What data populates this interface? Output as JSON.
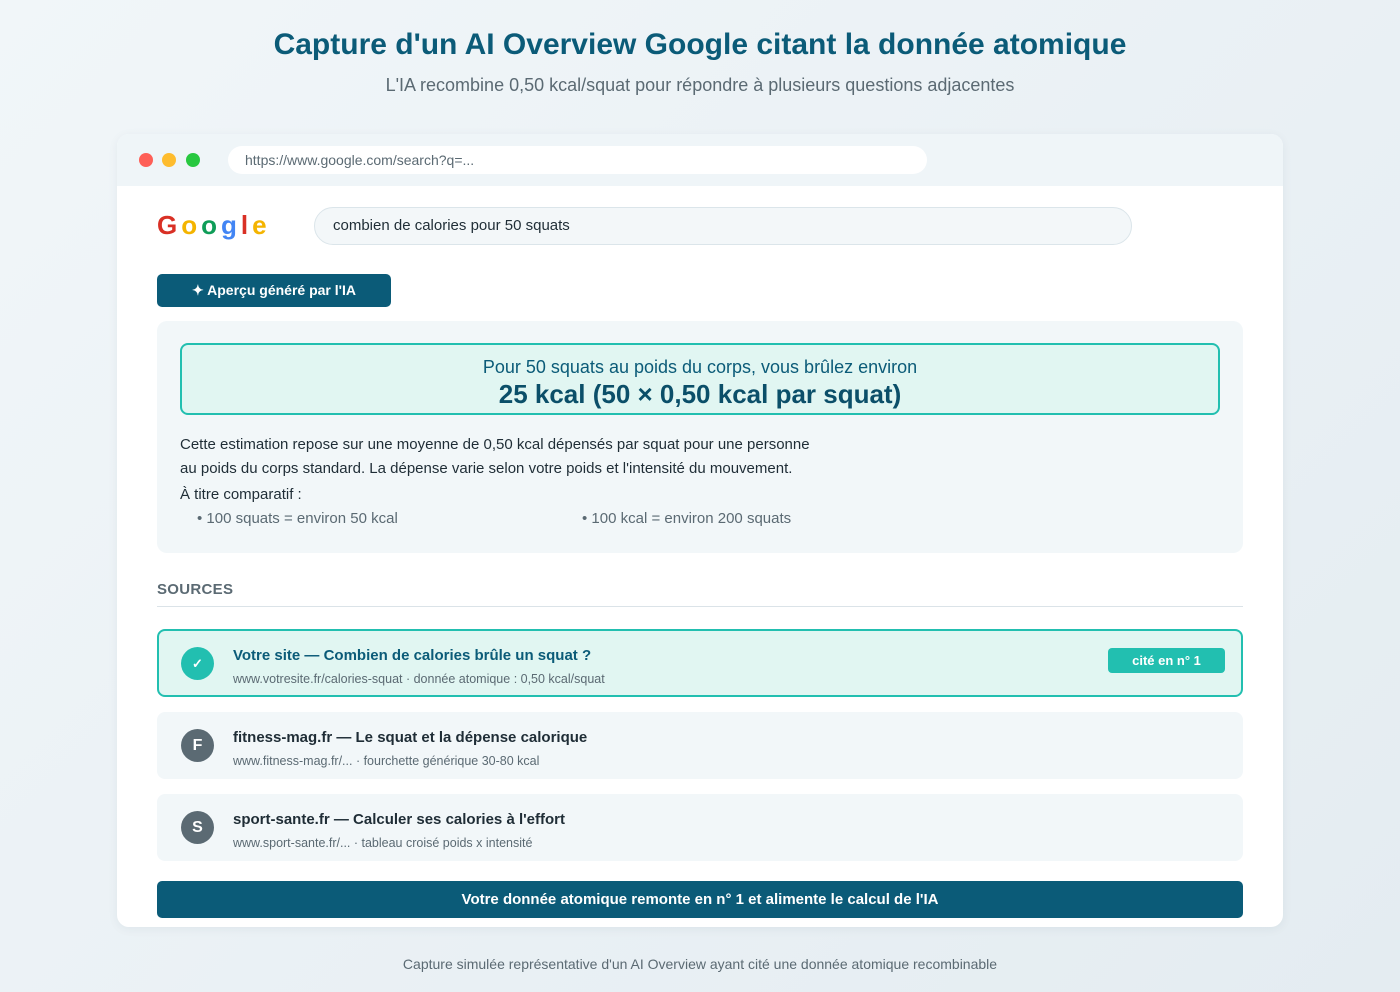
{
  "header": {
    "title": "Capture d'un AI Overview Google citant la donnée atomique",
    "subtitle": "L'IA recombine 0,50 kcal/squat pour répondre à plusieurs questions adjacentes"
  },
  "browser": {
    "url": "https://www.google.com/search?q=...",
    "window_controls": [
      "close",
      "minimize",
      "maximize"
    ]
  },
  "google": {
    "logo_letters": [
      "G",
      "o",
      "o",
      "g",
      "l",
      "e"
    ],
    "logo_colors": [
      "#d93025",
      "#f4b400",
      "#0f9d58",
      "#4285f4",
      "#d93025",
      "#f4b400"
    ],
    "query": "combien de calories pour 50 squats"
  },
  "ai_overview": {
    "badge_icon": "sparkle-icon",
    "badge_label": "Aperçu généré par l'IA",
    "answer_line1": "Pour 50 squats au poids du corps, vous brûlez environ",
    "answer_line2": "25 kcal (50 × 0,50 kcal par squat)",
    "explanation_line1": "Cette estimation repose sur une moyenne de 0,50 kcal dépensés par squat pour une personne",
    "explanation_line2": "au poids du corps standard. La dépense varie selon votre poids et l'intensité du mouvement.",
    "compare_label": "À titre comparatif :",
    "compare_items": [
      "• 100 squats = environ 50 kcal",
      "• 100 kcal = environ 200 squats"
    ]
  },
  "sources": {
    "heading": "SOURCES",
    "items": [
      {
        "avatar": "✓",
        "title": "Votre site — Combien de calories brûle un squat ?",
        "meta": "www.votresite.fr/calories-squat · donnée atomique : 0,50 kcal/squat",
        "badge": "cité en n° 1"
      },
      {
        "avatar": "F",
        "title": "fitness-mag.fr — Le squat et la dépense calorique",
        "meta": "www.fitness-mag.fr/... · fourchette générique 30-80 kcal"
      },
      {
        "avatar": "S",
        "title": "sport-sante.fr — Calculer ses calories à l'effort",
        "meta": "www.sport-sante.fr/... · tableau croisé poids x intensité"
      }
    ]
  },
  "banner": "Votre donnée atomique remonte en n° 1 et alimente le calcul de l'IA",
  "caption": "Capture simulée représentative d'un AI Overview ayant cité une donnée atomique recombinable",
  "colors": {
    "primary": "#0b5b78",
    "accent": "#22bfb0",
    "accent_bg": "#e1f6f2"
  }
}
